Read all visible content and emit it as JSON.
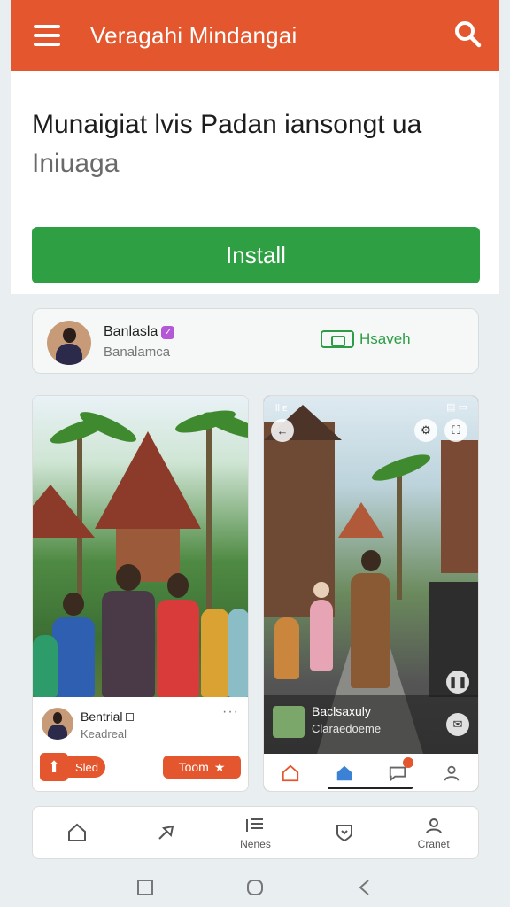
{
  "header": {
    "title": "Veragahi Mindangai",
    "menu_icon": "hamburger-icon",
    "search_icon": "search-icon",
    "color": "#e4572e"
  },
  "hero": {
    "headline": "Munaigiat lvis Padan iansongt ua",
    "subheadline": "Iniuaga",
    "install_label": "Install",
    "install_color": "#2ea043"
  },
  "creator": {
    "name": "Banlasla",
    "subtitle": "Banalamca",
    "action_label": "Hsaveh",
    "action_icon": "cast-icon"
  },
  "cards": [
    {
      "author": "Bentrial",
      "subtitle": "Keadreal",
      "left_button": "Sled",
      "right_button": "Toom",
      "more": "···"
    },
    {
      "status_left": "ıll ᴇ",
      "status_right": "▤ ▭",
      "author": "Baclsaxuly",
      "subtitle": "Claraedoeme"
    }
  ],
  "tabbar": {
    "items": [
      {
        "label": "",
        "icon": "home-icon"
      },
      {
        "label": "",
        "icon": "share-icon"
      },
      {
        "label": "Nenes",
        "icon": "news-icon"
      },
      {
        "label": "",
        "icon": "shield-heart-icon"
      },
      {
        "label": "Cranet",
        "icon": "profile-icon"
      }
    ]
  }
}
